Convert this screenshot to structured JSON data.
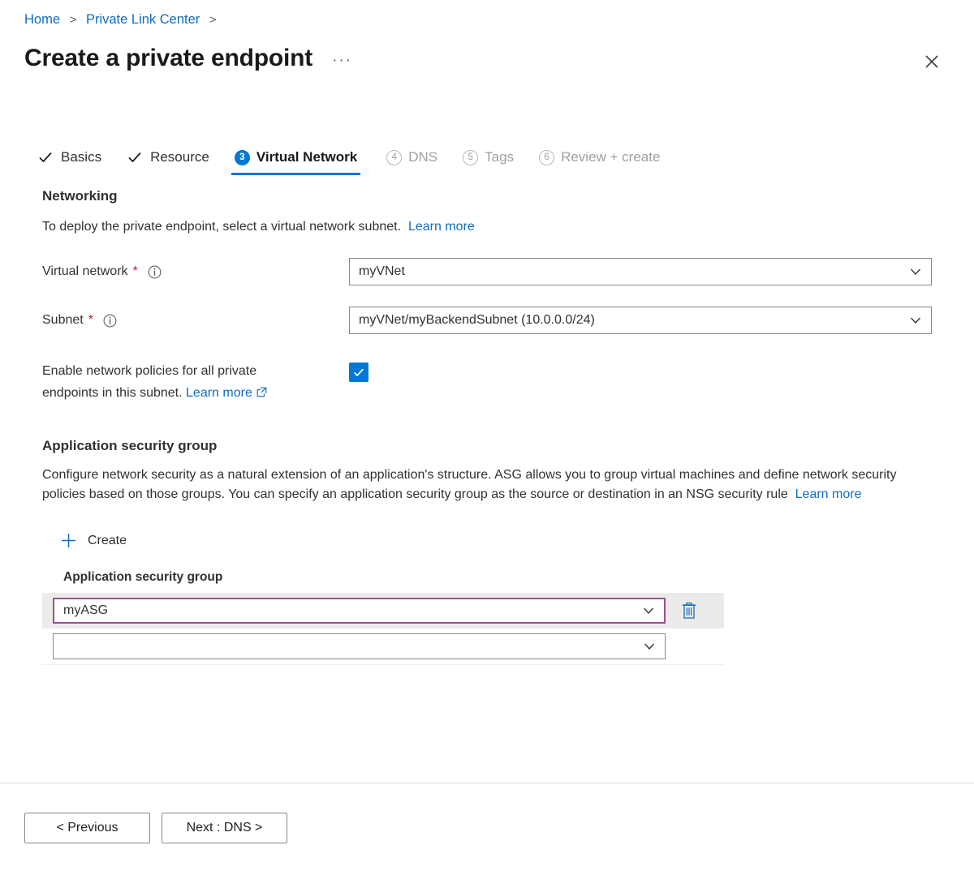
{
  "breadcrumb": {
    "items": [
      "Home",
      "Private Link Center"
    ],
    "separator": ">"
  },
  "header": {
    "title": "Create a private endpoint",
    "ellipsis": "···",
    "close_icon": "close-icon"
  },
  "tabs": [
    {
      "label": "Basics",
      "state": "completed",
      "marker": "check"
    },
    {
      "label": "Resource",
      "state": "completed",
      "marker": "check"
    },
    {
      "label": "Virtual Network",
      "state": "active",
      "marker": "3"
    },
    {
      "label": "DNS",
      "state": "disabled",
      "marker": "4"
    },
    {
      "label": "Tags",
      "state": "disabled",
      "marker": "5"
    },
    {
      "label": "Review + create",
      "state": "disabled",
      "marker": "6"
    }
  ],
  "networking": {
    "heading": "Networking",
    "description": "To deploy the private endpoint, select a virtual network subnet.",
    "learn_more": "Learn more",
    "virtual_network": {
      "label": "Virtual network",
      "required_marker": "*",
      "value": "myVNet"
    },
    "subnet": {
      "label": "Subnet",
      "required_marker": "*",
      "value": "myVNet/myBackendSubnet (10.0.0.0/24)"
    },
    "network_policies": {
      "label_line1": "Enable network policies for all private",
      "label_line2": "endpoints in this subnet.",
      "learn_more": "Learn more",
      "checked": true
    }
  },
  "application_security_group": {
    "heading": "Application security group",
    "description": "Configure network security as a natural extension of an application's structure. ASG allows you to group virtual machines and define network security policies based on those groups. You can specify an application security group as the source or destination in an NSG security rule",
    "learn_more": "Learn more",
    "create_label": "Create",
    "column_header": "Application security group",
    "rows": [
      {
        "value": "myASG",
        "selected": true,
        "has_delete": true
      },
      {
        "value": "",
        "selected": false,
        "has_delete": false
      }
    ]
  },
  "footer": {
    "previous_label": "< Previous",
    "next_label": "Next : DNS >"
  },
  "colors": {
    "accent": "#0078d4",
    "link": "#0f6cbd",
    "required": "#a4262c",
    "focus_border": "#9b4f96",
    "row_selected_bg": "#edebe9"
  }
}
